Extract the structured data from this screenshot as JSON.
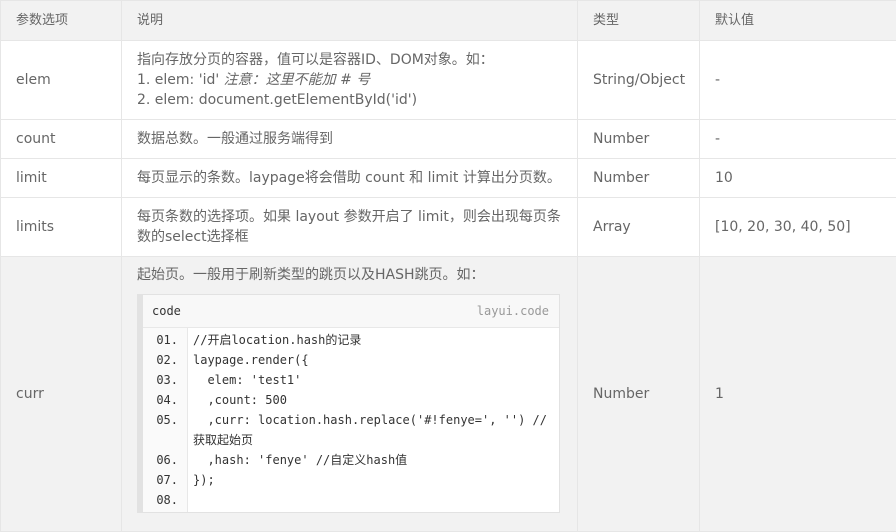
{
  "header": {
    "param": "参数选项",
    "desc": "说明",
    "type": "类型",
    "default": "默认值"
  },
  "rows": [
    {
      "param": "elem",
      "desc_main": "指向存放分页的容器，值可以是容器ID、DOM对象。如：",
      "desc_line1_prefix": "1. elem: 'id' ",
      "desc_line1_em": "注意：这里不能加 # 号",
      "desc_line2": "2. elem: document.getElementById('id')",
      "type": "String/Object",
      "default": "-"
    },
    {
      "param": "count",
      "desc": "数据总数。一般通过服务端得到",
      "type": "Number",
      "default": "-"
    },
    {
      "param": "limit",
      "desc": "每页显示的条数。laypage将会借助 count 和 limit 计算出分页数。",
      "type": "Number",
      "default": "10"
    },
    {
      "param": "limits",
      "desc": "每页条数的选择项。如果 layout 参数开启了 limit，则会出现每页条数的select选择框",
      "type": "Array",
      "default": "[10, 20, 30, 40, 50]"
    },
    {
      "param": "curr",
      "desc": "起始页。一般用于刷新类型的跳页以及HASH跳页。如：",
      "type": "Number",
      "default": "1",
      "code": {
        "title": "code",
        "brand": "layui.code",
        "line_numbers": [
          "01.",
          "02.",
          "03.",
          "04.",
          "05.",
          "",
          "06.",
          "07.",
          "08."
        ],
        "lines": [
          "//开启location.hash的记录",
          "laypage.render({",
          "  elem: 'test1'",
          "  ,count: 500",
          "  ,curr: location.hash.replace('#!fenye=', '') //",
          "获取起始页",
          "  ,hash: 'fenye' //自定义hash值",
          "});",
          ""
        ]
      }
    }
  ]
}
